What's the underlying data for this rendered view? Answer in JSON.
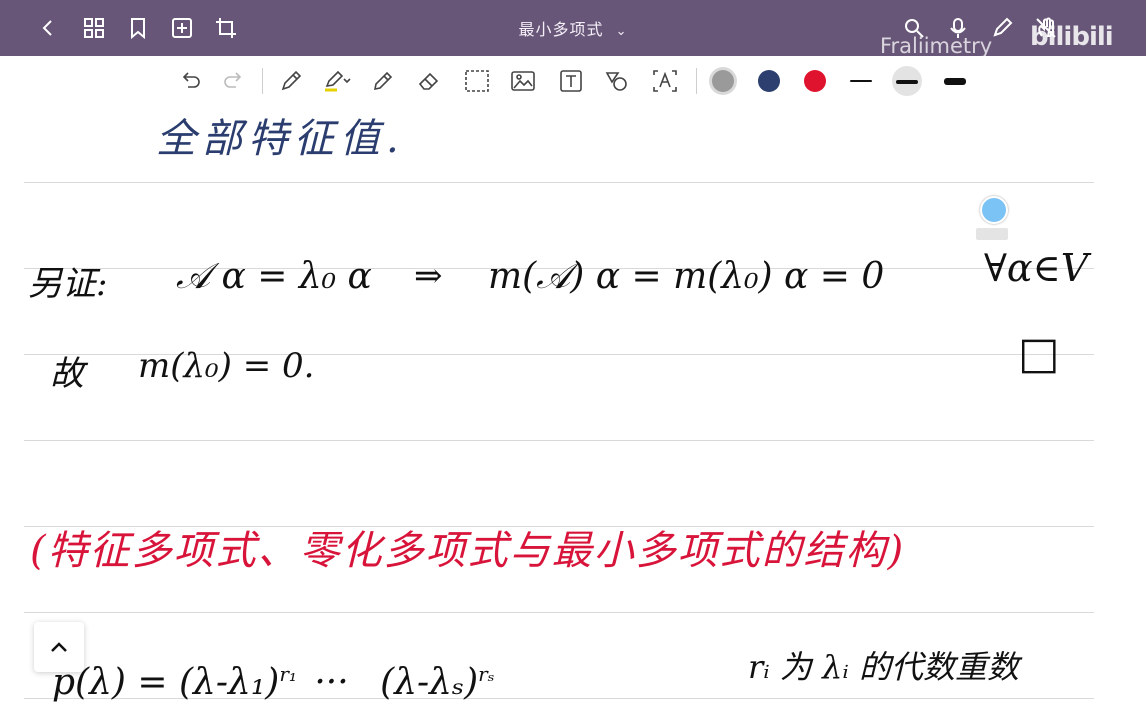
{
  "header": {
    "title": "最小多项式",
    "watermark": "Fraliimetry",
    "brand": "bilibili"
  },
  "colors": {
    "titlebar": "#675677",
    "pen_gray": "#9a9a9a",
    "pen_navy": "#2c3f6e",
    "pen_red": "#e0132f"
  },
  "note": {
    "line1": "全部特征值.",
    "line2_a": "另证:",
    "line2_b": "𝒜 α = λ₀ α",
    "line2_c": "⇒",
    "line2_d": "m(𝒜) α = m(λ₀) α = 0",
    "line2_e": "∀α∈V",
    "line3_a": "故",
    "line3_b": "m(λ₀) = 0.",
    "qed": "□",
    "heading_red": "(特征多项式、零化多项式与最小多项式的结构)",
    "formula": "p(λ) = (λ-λ₁)",
    "formula_exp1": "r₁",
    "formula_mid": "···",
    "formula_tail": "(λ-λₛ)",
    "formula_exp2": "rₛ",
    "formula_note": "rᵢ 为 λᵢ 的代数重数"
  }
}
